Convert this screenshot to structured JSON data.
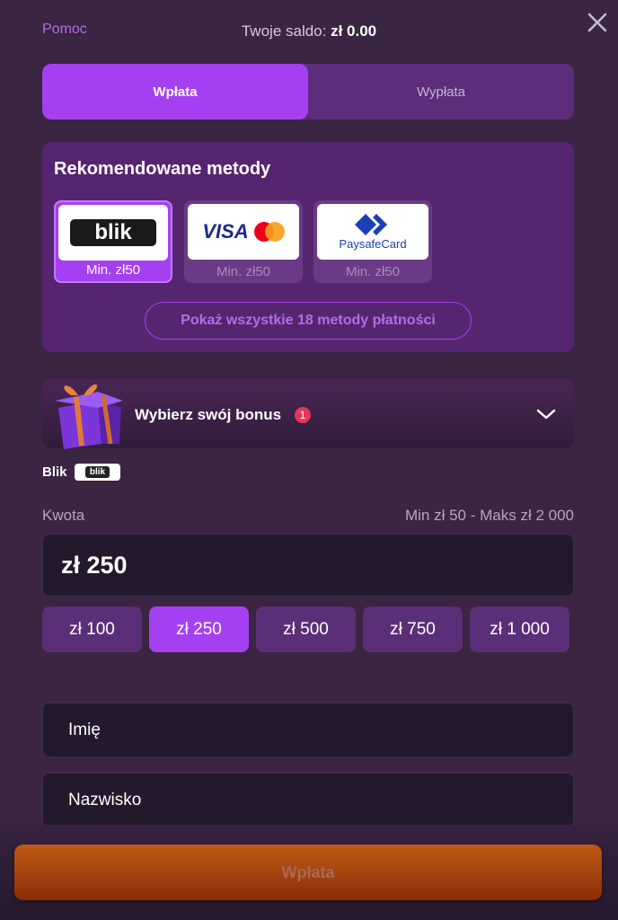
{
  "header": {
    "help_label": "Pomoc",
    "balance_label": "Twoje saldo:",
    "balance_value": "zł 0.00"
  },
  "tabs": [
    {
      "label": "Wpłata",
      "active": true
    },
    {
      "label": "Wypłata",
      "active": false
    }
  ],
  "recommended": {
    "title": "Rekomendowane metody",
    "methods": [
      {
        "name": "blik",
        "logo_text": "blik",
        "min": "Min. zł50",
        "selected": true
      },
      {
        "name": "visa-mastercard",
        "logo_text": "VISA",
        "logo_sub": "mastercard",
        "min": "Min. zł50",
        "selected": false
      },
      {
        "name": "paysafecard",
        "logo_text": "PaysafeCard",
        "min": "Min. zł50",
        "selected": false
      }
    ],
    "show_all_label": "Pokaż wszystkie 18 metody płatności"
  },
  "bonus": {
    "title": "Wybierz swój bonus",
    "badge_count": "1"
  },
  "selected_method": {
    "label": "Blik",
    "chip_text": "blik"
  },
  "amount": {
    "label": "Kwota",
    "range": "Min zł 50 - Maks zł 2 000",
    "value": "zł 250",
    "presets": [
      {
        "label": "zł 100",
        "active": false
      },
      {
        "label": "zł 250",
        "active": true
      },
      {
        "label": "zł 500",
        "active": false
      },
      {
        "label": "zł 750",
        "active": false
      },
      {
        "label": "zł 1 000",
        "active": false
      }
    ]
  },
  "form": {
    "first_name_placeholder": "Imię",
    "last_name_placeholder": "Nazwisko"
  },
  "submit_label": "Wpłata",
  "colors": {
    "background": "#3a2542",
    "accent": "#a540f2",
    "submit": "#c25a16"
  },
  "icons": [
    "close-icon",
    "chevron-down-icon",
    "gift-icon"
  ]
}
